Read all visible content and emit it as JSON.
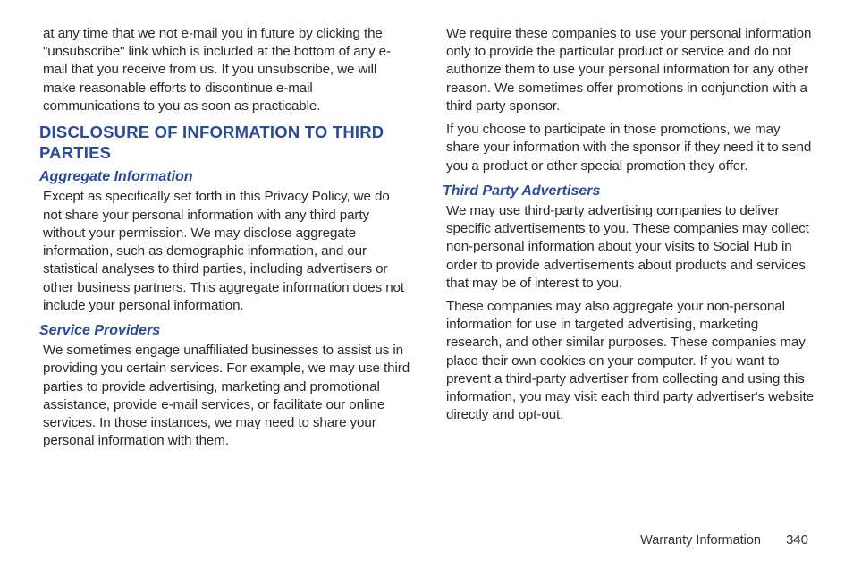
{
  "left": {
    "p1": "at any time that we not e-mail you in future by clicking the \"unsubscribe\" link which is included at the bottom of any e-mail that you receive from us. If you unsubscribe, we will make reasonable efforts to discontinue e-mail communications to you as soon as practicable.",
    "h1": "Disclosure of Information to Third Parties",
    "h2a": "Aggregate Information",
    "p2": "Except as specifically set forth in this Privacy Policy, we do not share your personal information with any third party without your permission. We may disclose aggregate information, such as demographic information, and our statistical analyses to third parties, including advertisers or other business partners. This aggregate information does not include your personal information.",
    "h2b": "Service Providers",
    "p3": "We sometimes engage unaffiliated businesses to assist us in providing you certain services. For example, we may use third parties to provide advertising, marketing and promotional assistance, provide e-mail services, or facilitate our online services. In those instances, we may need to share your personal information with them."
  },
  "right": {
    "p1": "We require these companies to use your personal information only to provide the particular product or service and do not authorize them to use your personal information for any other reason. We sometimes offer promotions in conjunction with a third party sponsor.",
    "p2": "If you choose to participate in those promotions, we may share your information with the sponsor if they need it to send you a product or other special promotion they offer.",
    "h2a": "Third Party Advertisers",
    "p3": "We may use third-party advertising companies to deliver specific advertisements to you. These companies may collect non-personal information about your visits to Social Hub in order to provide advertisements about products and services that may be of interest to you.",
    "p4": "These companies may also aggregate your non-personal information for use in targeted advertising, marketing research, and other similar purposes. These companies may place their own cookies on your computer. If you want to prevent a third-party advertiser from collecting and using this information, you may visit each third party advertiser's website directly and opt-out."
  },
  "footer": {
    "section": "Warranty Information",
    "page": "340"
  }
}
